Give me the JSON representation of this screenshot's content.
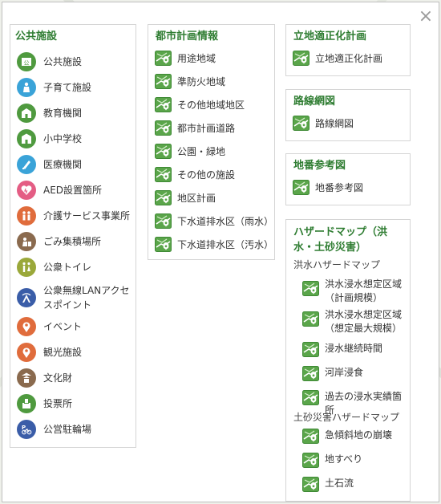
{
  "close_label": "×",
  "col1": {
    "title": "公共施設",
    "items": [
      {
        "label": "公共施設",
        "icon": "public-building-icon",
        "color": "#4f9a3f"
      },
      {
        "label": "子育て施設",
        "icon": "childcare-icon",
        "color": "#3aa3d8"
      },
      {
        "label": "教育機関",
        "icon": "school-icon",
        "color": "#4f9a3f"
      },
      {
        "label": "小中学校",
        "icon": "elementary-school-icon",
        "color": "#4f9a3f"
      },
      {
        "label": "医療機関",
        "icon": "medical-icon",
        "color": "#3aa3d8"
      },
      {
        "label": "AED設置箇所",
        "icon": "aed-icon",
        "color": "#e45d84"
      },
      {
        "label": "介護サービス事業所",
        "icon": "care-service-icon",
        "color": "#e06c3c"
      },
      {
        "label": "ごみ集積場所",
        "icon": "garbage-icon",
        "color": "#8a6a4e"
      },
      {
        "label": "公衆トイレ",
        "icon": "toilet-icon",
        "color": "#9aa83a"
      },
      {
        "label_line1": "公衆無線LANアクセ",
        "label_line2": "スポイント",
        "icon": "wifi-icon",
        "color": "#3a5da8"
      },
      {
        "label": "イベント",
        "icon": "event-icon",
        "color": "#e06c3c"
      },
      {
        "label": "観光施設",
        "icon": "sightseeing-icon",
        "color": "#e06c3c"
      },
      {
        "label": "文化財",
        "icon": "cultural-property-icon",
        "color": "#8a6a4e"
      },
      {
        "label": "投票所",
        "icon": "polling-place-icon",
        "color": "#4f9a3f"
      },
      {
        "label": "公営駐輪場",
        "icon": "bicycle-parking-icon",
        "color": "#3a5da8"
      }
    ]
  },
  "col2": {
    "title": "都市計画情報",
    "items": [
      {
        "label": "用途地域"
      },
      {
        "label": "準防火地域"
      },
      {
        "label": "その他地域地区"
      },
      {
        "label": "都市計画道路"
      },
      {
        "label": "公園・緑地"
      },
      {
        "label": "その他の施設"
      },
      {
        "label": "地区計画"
      },
      {
        "label": "下水道排水区（雨水）"
      },
      {
        "label": "下水道排水区（汚水）"
      }
    ]
  },
  "col3": {
    "box1": {
      "title": "立地適正化計画",
      "item": "立地適正化計画"
    },
    "box2": {
      "title": "路線網図",
      "item": "路線網図"
    },
    "box3": {
      "title": "地番参考図",
      "item": "地番参考図"
    },
    "box4": {
      "title_line1": "ハザードマップ（洪",
      "title_line2": "水・土砂災害）",
      "flood_head": "洪水ハザードマップ",
      "flood_items": [
        {
          "line1": "洪水浸水想定区域",
          "line2": "（計画規模）"
        },
        {
          "line1": "洪水浸水想定区域",
          "line2": "（想定最大規模）"
        },
        {
          "line1": "浸水継続時間"
        },
        {
          "line1": "河岸浸食"
        },
        {
          "line1": "過去の浸水実績箇所"
        }
      ],
      "sediment_head": "土砂災害ハザードマップ",
      "sediment_items": [
        {
          "line1": "急傾斜地の崩壊"
        },
        {
          "line1": "地すべり"
        },
        {
          "line1": "土石流"
        }
      ]
    }
  }
}
